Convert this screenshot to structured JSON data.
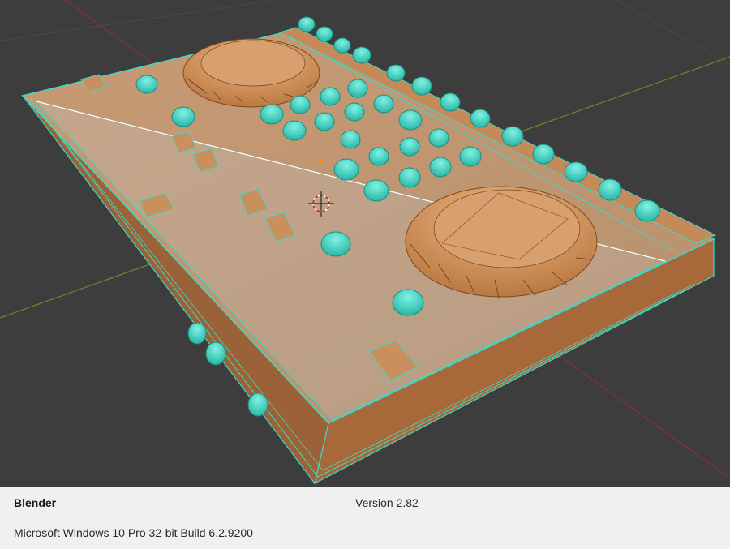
{
  "footer": {
    "app_name": "Blender",
    "version": "Version 2.82",
    "os_info": "Microsoft Windows 10 Pro 32-bit Build 6.2.9200"
  },
  "viewport": {
    "background_color": "#3d3d3d",
    "model_color": "#b97a47",
    "selected_edge_color": "#3fd9c8",
    "x_axis_color": "#8a2f3c",
    "y_axis_color": "#6a8a2a"
  }
}
